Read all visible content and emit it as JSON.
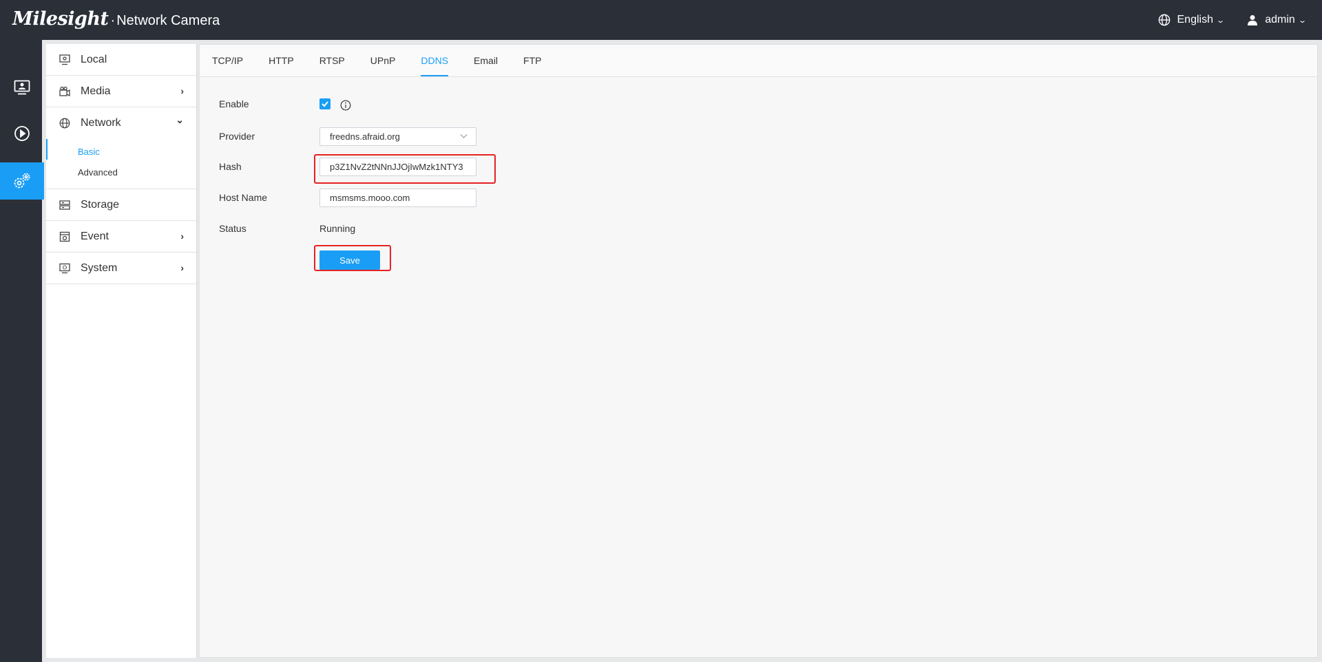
{
  "header": {
    "brand": "Milesight",
    "separator": "·",
    "product": "Network Camera",
    "language": "English",
    "user": "admin",
    "language_icon": "globe-icon",
    "user_icon": "user-icon"
  },
  "rail": {
    "items": [
      {
        "name": "live-view",
        "icon": "monitor-icon"
      },
      {
        "name": "playback",
        "icon": "play-circle-icon"
      },
      {
        "name": "settings",
        "icon": "gears-icon",
        "active": true
      }
    ]
  },
  "sidebar": {
    "items": [
      {
        "label": "Local",
        "icon": "local-icon"
      },
      {
        "label": "Media",
        "icon": "media-icon",
        "arrow": "›"
      },
      {
        "label": "Network",
        "icon": "globe-icon",
        "arrow": "⌄",
        "expanded": true,
        "children": [
          {
            "label": "Basic",
            "active": true
          },
          {
            "label": "Advanced"
          }
        ]
      },
      {
        "label": "Storage",
        "icon": "storage-icon"
      },
      {
        "label": "Event",
        "icon": "event-icon",
        "arrow": "›"
      },
      {
        "label": "System",
        "icon": "system-icon",
        "arrow": "›"
      }
    ]
  },
  "tabs": [
    {
      "label": "TCP/IP"
    },
    {
      "label": "HTTP"
    },
    {
      "label": "RTSP"
    },
    {
      "label": "UPnP"
    },
    {
      "label": "DDNS",
      "active": true
    },
    {
      "label": "Email"
    },
    {
      "label": "FTP"
    }
  ],
  "form": {
    "enable_label": "Enable",
    "enable_checked": true,
    "provider_label": "Provider",
    "provider_value": "freedns.afraid.org",
    "hash_label": "Hash",
    "hash_value": "p3Z1NvZ2tNNnJJOjIwMzk1NTY3",
    "hostname_label": "Host Name",
    "hostname_value": "msmsms.mooo.com",
    "status_label": "Status",
    "status_value": "Running",
    "save_label": "Save"
  },
  "colors": {
    "accent": "#1a9ef5",
    "header_bg": "#2b2f38",
    "highlight": "#e62121"
  }
}
